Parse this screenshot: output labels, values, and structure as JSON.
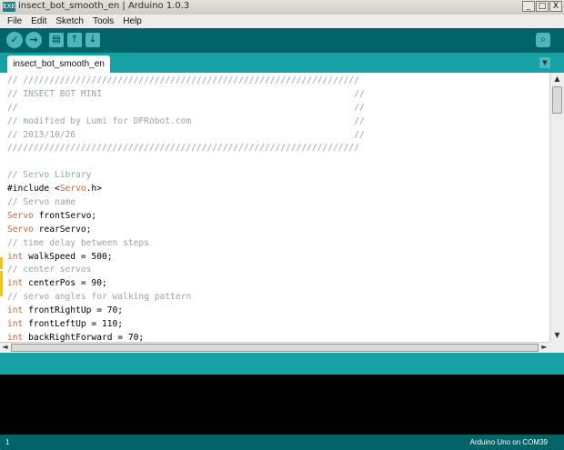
{
  "window": {
    "app_icon_text": "EXE",
    "title": "insect_bot_smooth_en | Arduino 1.0.3",
    "controls": [
      "_",
      "□",
      "X"
    ]
  },
  "menu": [
    "File",
    "Edit",
    "Sketch",
    "Tools",
    "Help"
  ],
  "toolbar": {
    "verify_icon": "✓",
    "upload_icon": "→",
    "new_icon": "▤",
    "open_icon": "↑",
    "save_icon": "↓",
    "serial_monitor_icon": "⌕"
  },
  "tabs": [
    {
      "label": "insect_bot_smooth_en"
    }
  ],
  "tab_menu_icon": "▼",
  "code_lines": [
    [
      {
        "t": "// ////////////////////////////////////////////////////////////////",
        "c": "comment"
      }
    ],
    [
      {
        "t": "// INSECT BOT MINI                                                //",
        "c": "comment"
      }
    ],
    [
      {
        "t": "//                                                                //",
        "c": "comment"
      }
    ],
    [
      {
        "t": "// modified by Lumi for DFRobot.com                               //",
        "c": "comment"
      }
    ],
    [
      {
        "t": "// 2013/10/26                                                     //",
        "c": "comment"
      }
    ],
    [
      {
        "t": "///////////////////////////////////////////////////////////////////",
        "c": "comment"
      }
    ],
    [
      {
        "t": "",
        "c": "plain"
      }
    ],
    [
      {
        "t": "// Servo Library",
        "c": "comment"
      }
    ],
    [
      {
        "t": "#include <",
        "c": "plain"
      },
      {
        "t": "Servo",
        "c": "type"
      },
      {
        "t": ".h>",
        "c": "plain"
      }
    ],
    [
      {
        "t": "// Servo name",
        "c": "comment"
      }
    ],
    [
      {
        "t": "Servo",
        "c": "type"
      },
      {
        "t": " frontServo;",
        "c": "plain"
      }
    ],
    [
      {
        "t": "Servo",
        "c": "type"
      },
      {
        "t": " rearServo;",
        "c": "plain"
      }
    ],
    [
      {
        "t": "// time delay between steps",
        "c": "comment"
      }
    ],
    [
      {
        "t": "int",
        "c": "type"
      },
      {
        "t": " walkSpeed = 500;",
        "c": "plain"
      }
    ],
    [
      {
        "t": "// center servos",
        "c": "comment"
      }
    ],
    [
      {
        "t": "int",
        "c": "type"
      },
      {
        "t": " centerPos = 90;",
        "c": "plain"
      }
    ],
    [
      {
        "t": "// servo angles for walking pattern",
        "c": "comment"
      }
    ],
    [
      {
        "t": "int",
        "c": "type"
      },
      {
        "t": " frontRightUp = 70;",
        "c": "plain"
      }
    ],
    [
      {
        "t": "int",
        "c": "type"
      },
      {
        "t": " frontLeftUp = 110;",
        "c": "plain"
      }
    ],
    [
      {
        "t": "int",
        "c": "type"
      },
      {
        "t": " backRightForward = 70;",
        "c": "plain"
      }
    ]
  ],
  "scroll": {
    "up": "▲",
    "down": "▼",
    "left": "◄",
    "right": "►"
  },
  "status": {
    "line_number": "1",
    "board": "Arduino Uno on COM39"
  },
  "colors": {
    "toolbar": "#006468",
    "tabstrip": "#17a1a5",
    "button": "#4db7bb",
    "comment": "#95a5a6",
    "type": "#cc6633",
    "console": "#000000"
  }
}
